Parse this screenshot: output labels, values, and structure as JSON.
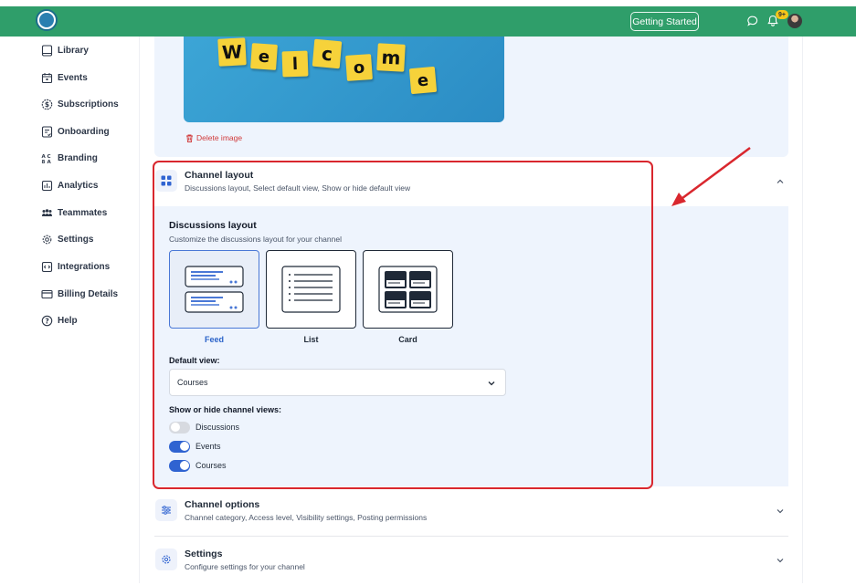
{
  "header": {
    "getting_started_label": "Getting Started",
    "notification_count": "9+"
  },
  "sidebar": {
    "items": [
      {
        "label": "Library",
        "icon": "book-icon"
      },
      {
        "label": "Events",
        "icon": "calendar-icon"
      },
      {
        "label": "Subscriptions",
        "icon": "dollar-icon"
      },
      {
        "label": "Onboarding",
        "icon": "onboarding-icon"
      },
      {
        "label": "Branding",
        "icon": "branding-icon"
      },
      {
        "label": "Analytics",
        "icon": "analytics-icon"
      },
      {
        "label": "Teammates",
        "icon": "teammates-icon"
      },
      {
        "label": "Settings",
        "icon": "gear-icon"
      },
      {
        "label": "Integrations",
        "icon": "integrations-icon"
      },
      {
        "label": "Billing Details",
        "icon": "card-icon"
      },
      {
        "label": "Help",
        "icon": "help-icon"
      }
    ]
  },
  "image_card": {
    "welcome_letters": [
      "W",
      "e",
      "l",
      "c",
      "o",
      "m",
      "e"
    ],
    "delete_label": "Delete image"
  },
  "channel_layout": {
    "title": "Channel layout",
    "subtitle": "Discussions layout, Select default view, Show or hide default view",
    "discussions_title": "Discussions layout",
    "discussions_subtitle": "Customize the discussions layout for your channel",
    "options": [
      "Feed",
      "List",
      "Card"
    ],
    "selected_option": "Feed",
    "default_view_label": "Default view:",
    "default_view_value": "Courses",
    "show_hide_label": "Show or hide channel views:",
    "views": [
      {
        "label": "Discussions",
        "enabled": false
      },
      {
        "label": "Events",
        "enabled": true
      },
      {
        "label": "Courses",
        "enabled": true
      }
    ]
  },
  "channel_options": {
    "title": "Channel options",
    "subtitle": "Channel category, Access level, Visibility settings, Posting permissions"
  },
  "settings_section": {
    "title": "Settings",
    "subtitle": "Configure settings for your channel"
  },
  "colors": {
    "header_green": "#2f9e6a",
    "accent_blue": "#2f63d1",
    "highlight_red": "#d9272e",
    "panel_bg": "#eef4fd"
  }
}
